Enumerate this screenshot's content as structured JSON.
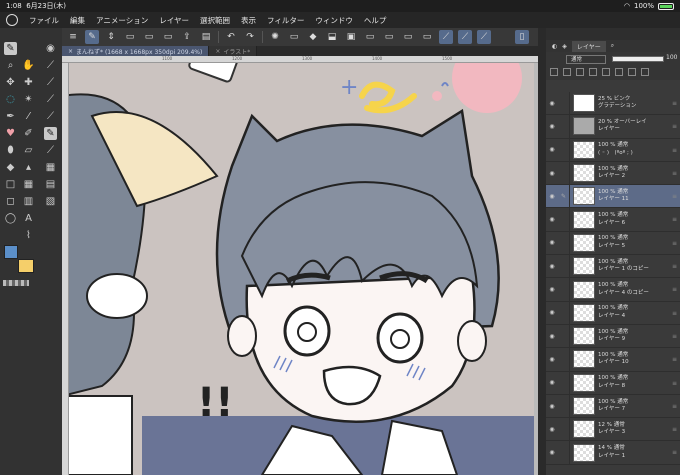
{
  "status": {
    "time": "1:08",
    "date": "6月23日(木)",
    "battery": "100%"
  },
  "menu": [
    "ファイル",
    "編集",
    "アニメーション",
    "レイヤー",
    "選択範囲",
    "表示",
    "フィルター",
    "ウィンドウ",
    "ヘルプ"
  ],
  "tabs": [
    {
      "label": "まんねず* (1668 x 1668px 350dpi 209.4%)",
      "active": true
    },
    {
      "label": "イラスト*",
      "active": false
    }
  ],
  "colors": {
    "main": "#5b8fc9",
    "sub": "#f5cf6a",
    "accent": "#566b8c",
    "selected_layer": "#5d6b88"
  },
  "layer_panel": {
    "tab_label": "レイヤー",
    "blend_mode": "通常",
    "opacity": "100"
  },
  "layers": [
    {
      "line1": "25 % ビンク",
      "line2": "グラデーション",
      "thumb": "white",
      "selected": false
    },
    {
      "line1": "20 % オーバーレイ",
      "line2": "レイヤー",
      "thumb": "gray",
      "selected": false
    },
    {
      "line1": "100 % 通常",
      "line2": "( ◦ )　(ºoº ; )",
      "thumb": "checker",
      "selected": false
    },
    {
      "line1": "100 % 通常",
      "line2": "レイヤー 2",
      "thumb": "checker",
      "selected": false
    },
    {
      "line1": "100 % 通常",
      "line2": "レイヤー 11",
      "thumb": "checker",
      "selected": true
    },
    {
      "line1": "100 % 通常",
      "line2": "レイヤー 6",
      "thumb": "checker",
      "selected": false
    },
    {
      "line1": "100 % 通常",
      "line2": "レイヤー 5",
      "thumb": "checker",
      "selected": false
    },
    {
      "line1": "100 % 通常",
      "line2": "レイヤー 1 のコピー",
      "thumb": "checker",
      "selected": false
    },
    {
      "line1": "100 % 通常",
      "line2": "レイヤー 4 のコピー",
      "thumb": "checker",
      "selected": false
    },
    {
      "line1": "100 % 通常",
      "line2": "レイヤー 4",
      "thumb": "checker",
      "selected": false
    },
    {
      "line1": "100 % 通常",
      "line2": "レイヤー 9",
      "thumb": "checker",
      "selected": false
    },
    {
      "line1": "100 % 通常",
      "line2": "レイヤー 10",
      "thumb": "checker",
      "selected": false
    },
    {
      "line1": "100 % 通常",
      "line2": "レイヤー 8",
      "thumb": "checker",
      "selected": false
    },
    {
      "line1": "100 % 通常",
      "line2": "レイヤー 7",
      "thumb": "checker",
      "selected": false
    },
    {
      "line1": "12 % 通常",
      "line2": "レイヤー 3",
      "thumb": "checker",
      "selected": false
    },
    {
      "line1": "14 % 通常",
      "line2": "レイヤー 1",
      "thumb": "checker",
      "selected": false
    }
  ],
  "ruler_ticks": [
    "1100",
    "1200",
    "1300",
    "1400",
    "1500"
  ]
}
